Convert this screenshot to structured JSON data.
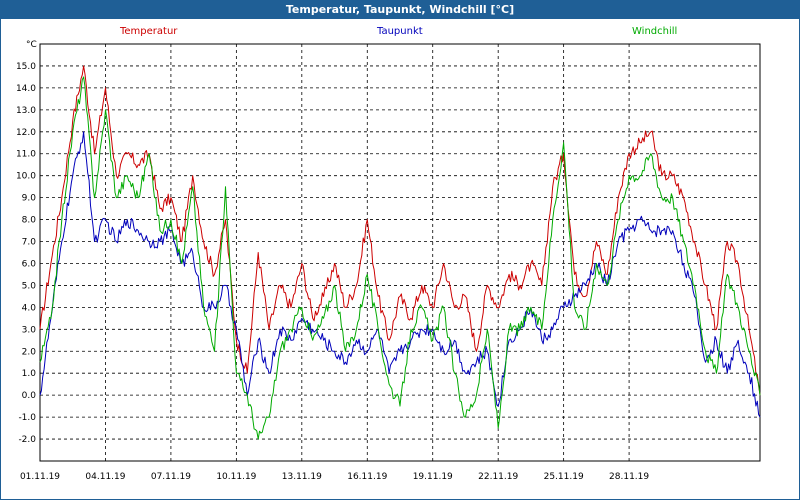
{
  "window": {
    "title": "Temperatur, Taupunkt, Windchill [°C]"
  },
  "chart_data": {
    "type": "line",
    "title": "Temperatur, Taupunkt, Windchill [°C]",
    "ylabel": "°C",
    "ylim": [
      -3,
      16
    ],
    "xlim": [
      0,
      33
    ],
    "grid": true,
    "legend_position": "top",
    "x_tick_labels": [
      "01.11.19",
      "04.11.19",
      "07.11.19",
      "10.11.19",
      "13.11.19",
      "16.11.19",
      "19.11.19",
      "22.11.19",
      "25.11.19",
      "28.11.19"
    ],
    "x_tick_days": [
      0,
      3,
      6,
      9,
      12,
      15,
      18,
      21,
      24,
      27
    ],
    "y_ticks": [
      -2,
      -1,
      0,
      1,
      2,
      3,
      4,
      5,
      6,
      7,
      8,
      9,
      10,
      11,
      12,
      13,
      14,
      15
    ],
    "y_tick_labels": [
      "-2.0",
      "-1.0",
      "0.0",
      "1.0",
      "2.0",
      "3.0",
      "4.0",
      "5.0",
      "6.0",
      "7.0",
      "8.0",
      "9.0",
      "10.0",
      "11.0",
      "12.0",
      "13.0",
      "14.0",
      "15.0"
    ],
    "series": [
      {
        "name": "Temperatur",
        "color": "#cc0000",
        "x": [
          0,
          0.5,
          1,
          1.5,
          2,
          2.5,
          3,
          3.5,
          4,
          4.5,
          5,
          5.5,
          6,
          6.5,
          7,
          7.5,
          8,
          8.5,
          9,
          9.5,
          10,
          10.5,
          11,
          11.5,
          12,
          12.5,
          13,
          13.5,
          14,
          14.5,
          15,
          15.5,
          16,
          16.5,
          17,
          17.5,
          18,
          18.5,
          19,
          19.5,
          20,
          20.5,
          21,
          21.5,
          22,
          22.5,
          23,
          23.5,
          24,
          24.5,
          25,
          25.5,
          26,
          26.5,
          27,
          27.5,
          28,
          28.5,
          29,
          29.5,
          30,
          30.5,
          31,
          31.5,
          32,
          32.5,
          33
        ],
        "values": [
          3,
          6,
          9,
          12.5,
          15,
          11,
          14,
          10,
          11,
          10.5,
          11,
          8.5,
          9,
          7,
          10,
          7,
          5.5,
          8,
          2.5,
          1,
          6.5,
          3,
          5,
          4,
          6,
          3.5,
          4.5,
          6,
          4,
          5,
          8,
          4.5,
          2.5,
          4.5,
          3.5,
          5,
          4,
          6,
          4,
          4.5,
          2,
          5,
          4,
          5.5,
          5,
          6,
          5,
          9.5,
          11,
          5.5,
          4.5,
          7,
          5.5,
          9,
          11,
          11.5,
          12,
          10,
          10,
          9,
          7,
          5,
          3,
          7,
          6,
          3,
          0
        ]
      },
      {
        "name": "Taupunkt",
        "color": "#0000bb",
        "x": [
          0,
          0.5,
          1,
          1.5,
          2,
          2.5,
          3,
          3.5,
          4,
          4.5,
          5,
          5.5,
          6,
          6.5,
          7,
          7.5,
          8,
          8.5,
          9,
          9.5,
          10,
          10.5,
          11,
          11.5,
          12,
          12.5,
          13,
          13.5,
          14,
          14.5,
          15,
          15.5,
          16,
          16.5,
          17,
          17.5,
          18,
          18.5,
          19,
          19.5,
          20,
          20.5,
          21,
          21.5,
          22,
          22.5,
          23,
          23.5,
          24,
          24.5,
          25,
          25.5,
          26,
          26.5,
          27,
          27.5,
          28,
          28.5,
          29,
          29.5,
          30,
          30.5,
          31,
          31.5,
          32,
          32.5,
          33
        ],
        "values": [
          0,
          3.5,
          7,
          10,
          12,
          7,
          8,
          7,
          8,
          7.5,
          7,
          7,
          7.5,
          6,
          6.5,
          4,
          4,
          5,
          3,
          0,
          2.5,
          1,
          3,
          2.5,
          3.5,
          3,
          2.5,
          2,
          1.5,
          2.5,
          2,
          3,
          1,
          2,
          2.5,
          3,
          3,
          2,
          2.5,
          1,
          1.5,
          2,
          -0.5,
          2.5,
          3,
          4,
          2.5,
          3,
          4,
          4.5,
          5,
          6,
          5,
          7,
          7.5,
          8,
          7.5,
          7.5,
          7.5,
          6,
          4.5,
          1.5,
          2.5,
          1,
          2.5,
          1,
          -1
        ]
      },
      {
        "name": "Windchill",
        "color": "#00aa00",
        "x": [
          0,
          0.5,
          1,
          1.5,
          2,
          2.5,
          3,
          3.5,
          4,
          4.5,
          5,
          5.5,
          6,
          6.5,
          7,
          7.5,
          8,
          8.5,
          9,
          9.5,
          10,
          10.5,
          11,
          11.5,
          12,
          12.5,
          13,
          13.5,
          14,
          14.5,
          15,
          15.5,
          16,
          16.5,
          17,
          17.5,
          18,
          18.5,
          19,
          19.5,
          20,
          20.5,
          21,
          21.5,
          22,
          22.5,
          23,
          23.5,
          24,
          24.5,
          25,
          25.5,
          26,
          26.5,
          27,
          27.5,
          28,
          28.5,
          29,
          29.5,
          30,
          30.5,
          31,
          31.5,
          32,
          32.5,
          33
        ],
        "values": [
          1.5,
          3.5,
          8,
          12,
          14.5,
          9,
          13,
          9,
          10,
          9,
          11,
          7.5,
          8,
          6,
          9.5,
          4,
          2,
          9.5,
          1,
          0,
          -2,
          -1,
          2,
          3,
          4,
          2.5,
          3.5,
          5,
          2,
          3,
          5.5,
          3,
          0.5,
          -0.5,
          3,
          4,
          2.5,
          4,
          1,
          -1,
          0,
          3,
          -1.5,
          3,
          3,
          4,
          3,
          8,
          11.5,
          4,
          3,
          6,
          5,
          8,
          10,
          10,
          11,
          9,
          9,
          7,
          5,
          2,
          1,
          5.5,
          4,
          2,
          0
        ]
      }
    ]
  }
}
